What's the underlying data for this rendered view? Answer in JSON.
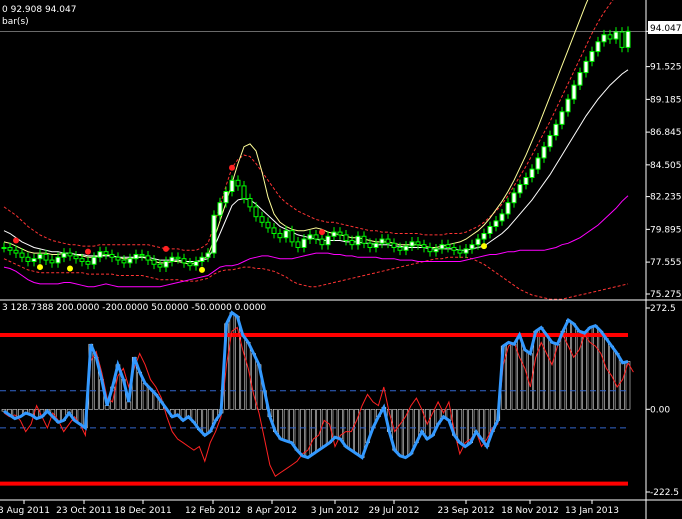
{
  "header": {
    "main_info": "0 92.908 94.047",
    "main_sub": "bar(s)",
    "osc_info": "3 128.7388 200.0000 -200.0000 50.0000 -50.0000 0.0000"
  },
  "price_tag": "94.047",
  "colors": {
    "background": "#000000",
    "grid": "#ffffff",
    "candle_bull": "#ffffff",
    "candle_body": "#00ff00",
    "ma_fast": "#ffffff",
    "ma_slow": "#ffff99",
    "band": "#ff3333",
    "lower_band": "#ff00ff",
    "cci": "#3399ff",
    "signal": "#ff2222",
    "level": "#ff0000",
    "dots_red": "#ff2222",
    "dots_yellow": "#ffff00"
  },
  "chart_data": [
    {
      "type": "candlestick",
      "ylim": [
        75.275,
        95.0
      ],
      "y_ticks": [
        "94.047",
        "91.525",
        "89.185",
        "86.845",
        "84.505",
        "82.235",
        "79.895",
        "77.555",
        "75.275"
      ],
      "y_tick_values": [
        94.047,
        91.525,
        89.185,
        86.845,
        84.505,
        82.235,
        79.895,
        77.555,
        75.275
      ],
      "x_ticks": [
        "3 Aug 2011",
        "23 Oct 2011",
        "18 Dec 2011",
        "12 Feb 2012",
        "8 Apr 2012",
        "3 Jun 2012",
        "29 Jul 2012",
        "23 Sep 2012",
        "18 Nov 2012",
        "13 Jan 2013"
      ],
      "close": [
        78.6,
        78.4,
        78.2,
        77.9,
        77.6,
        77.8,
        78.1,
        77.7,
        77.5,
        77.9,
        78.2,
        78.0,
        77.8,
        77.6,
        77.4,
        77.9,
        78.3,
        78.1,
        77.9,
        77.7,
        77.5,
        77.8,
        78.1,
        78.0,
        77.7,
        77.4,
        77.2,
        77.6,
        77.9,
        77.8,
        77.5,
        77.3,
        77.6,
        77.9,
        78.2,
        80.9,
        81.8,
        82.6,
        83.4,
        83.0,
        82.1,
        81.5,
        80.8,
        80.4,
        80.0,
        79.6,
        79.3,
        79.8,
        79.0,
        78.6,
        79.2,
        79.5,
        79.2,
        78.8,
        79.4,
        79.7,
        79.5,
        79.1,
        78.8,
        79.4,
        78.9,
        78.6,
        78.9,
        79.2,
        78.9,
        78.6,
        78.4,
        78.7,
        79.0,
        78.8,
        78.6,
        78.3,
        78.5,
        78.8,
        78.6,
        78.4,
        78.2,
        78.5,
        78.8,
        79.2,
        79.6,
        80.1,
        80.5,
        81.0,
        81.8,
        82.5,
        83.1,
        83.6,
        84.2,
        85.0,
        85.8,
        86.6,
        87.4,
        88.3,
        89.2,
        90.2,
        91.1,
        91.9,
        92.6,
        93.3,
        93.8,
        93.5,
        94.0,
        92.9,
        94.047
      ],
      "ma_fast": [
        79.8,
        79.6,
        79.3,
        79.0,
        78.8,
        78.6,
        78.5,
        78.4,
        78.3,
        78.3,
        78.2,
        78.2,
        78.1,
        78.1,
        78.0,
        78.0,
        78.0,
        78.0,
        78.0,
        77.9,
        77.9,
        77.9,
        77.9,
        77.9,
        77.9,
        77.8,
        77.7,
        77.7,
        77.7,
        77.7,
        77.6,
        77.6,
        77.6,
        77.7,
        77.8,
        78.6,
        79.6,
        80.6,
        81.6,
        82.0,
        82.1,
        82.0,
        81.7,
        81.3,
        80.9,
        80.5,
        80.1,
        79.9,
        79.7,
        79.5,
        79.4,
        79.3,
        79.2,
        79.1,
        79.1,
        79.1,
        79.1,
        79.0,
        79.0,
        79.0,
        78.9,
        78.9,
        78.8,
        78.8,
        78.8,
        78.7,
        78.7,
        78.6,
        78.6,
        78.6,
        78.6,
        78.5,
        78.5,
        78.5,
        78.5,
        78.5,
        78.4,
        78.4,
        78.5,
        78.6,
        78.7,
        79.0,
        79.3,
        79.6,
        80.0,
        80.5,
        81.0,
        81.5,
        82.0,
        82.6,
        83.2,
        83.8,
        84.5,
        85.2,
        85.9,
        86.6,
        87.3,
        88.0,
        88.6,
        89.2,
        89.7,
        90.2,
        90.6,
        91.0,
        91.3
      ],
      "ma_slow": [
        79.0,
        78.9,
        78.7,
        78.5,
        78.3,
        78.2,
        78.2,
        78.2,
        78.1,
        78.1,
        78.2,
        78.2,
        78.1,
        78.0,
        77.9,
        77.9,
        78.0,
        78.1,
        78.0,
        77.9,
        77.8,
        77.8,
        77.9,
        77.9,
        77.8,
        77.6,
        77.5,
        77.5,
        77.6,
        77.6,
        77.5,
        77.4,
        77.5,
        77.7,
        78.0,
        79.2,
        80.5,
        81.8,
        83.2,
        84.6,
        85.8,
        86.0,
        85.5,
        84.0,
        82.2,
        81.0,
        80.4,
        80.1,
        79.9,
        79.8,
        79.8,
        79.9,
        80.0,
        79.9,
        79.7,
        79.6,
        79.5,
        79.4,
        79.3,
        79.3,
        79.2,
        79.1,
        79.0,
        79.0,
        79.0,
        78.9,
        78.8,
        78.8,
        78.8,
        78.8,
        78.7,
        78.6,
        78.6,
        78.7,
        78.8,
        78.9,
        79.0,
        79.2,
        79.5,
        79.8,
        80.2,
        80.7,
        81.3,
        81.9,
        82.6,
        83.4,
        84.3,
        85.2,
        86.2,
        87.2,
        88.3,
        89.4,
        90.5,
        91.6,
        92.7,
        93.8,
        94.9,
        96.0,
        97.0,
        98.0,
        99.0,
        100.0,
        101.0,
        102.0,
        103.0
      ],
      "band_upper": [
        81.5,
        81.2,
        80.9,
        80.5,
        80.1,
        79.8,
        79.5,
        79.3,
        79.1,
        79.0,
        78.9,
        78.8,
        78.8,
        78.7,
        78.7,
        78.7,
        78.8,
        78.8,
        78.8,
        78.8,
        78.8,
        78.8,
        78.8,
        78.8,
        78.8,
        78.7,
        78.6,
        78.5,
        78.5,
        78.5,
        78.4,
        78.4,
        78.4,
        78.6,
        78.9,
        80.2,
        81.6,
        83.0,
        84.3,
        84.9,
        85.2,
        85.1,
        84.6,
        84.0,
        83.4,
        82.8,
        82.2,
        81.8,
        81.5,
        81.2,
        81.0,
        80.8,
        80.6,
        80.5,
        80.4,
        80.4,
        80.3,
        80.2,
        80.1,
        80.0,
        79.9,
        79.8,
        79.8,
        79.7,
        79.7,
        79.6,
        79.6,
        79.6,
        79.6,
        79.6,
        79.5,
        79.5,
        79.5,
        79.5,
        79.6,
        79.6,
        79.6,
        79.7,
        79.9,
        80.1,
        80.4,
        80.8,
        81.2,
        81.7,
        82.3,
        83.0,
        83.7,
        84.4,
        85.2,
        86.0,
        86.8,
        87.6,
        88.5,
        89.4,
        90.3,
        91.2,
        92.1,
        93.0,
        93.9,
        94.7,
        95.4,
        96.0,
        96.6,
        97.1,
        97.5
      ],
      "band_lower": [
        77.8,
        77.6,
        77.4,
        77.2,
        77.0,
        76.9,
        76.8,
        76.8,
        76.8,
        76.8,
        76.8,
        76.8,
        76.8,
        76.8,
        76.7,
        76.7,
        76.7,
        76.7,
        76.7,
        76.6,
        76.6,
        76.6,
        76.6,
        76.6,
        76.5,
        76.4,
        76.3,
        76.3,
        76.3,
        76.3,
        76.2,
        76.2,
        76.2,
        76.3,
        76.4,
        76.7,
        76.9,
        77.0,
        77.0,
        77.1,
        77.2,
        77.2,
        77.1,
        77.1,
        77.0,
        76.9,
        76.7,
        76.5,
        76.2,
        76.0,
        75.9,
        75.8,
        75.8,
        75.9,
        76.0,
        76.1,
        76.2,
        76.3,
        76.4,
        76.5,
        76.6,
        76.7,
        76.8,
        76.9,
        77.0,
        77.1,
        77.2,
        77.3,
        77.4,
        77.5,
        77.6,
        77.7,
        77.8,
        77.8,
        77.9,
        77.9,
        77.9,
        77.9,
        77.8,
        77.6,
        77.4,
        77.1,
        76.8,
        76.5,
        76.2,
        75.9,
        75.6,
        75.4,
        75.2,
        75.1,
        75.0,
        74.9,
        74.9,
        74.9,
        75.0,
        75.1,
        75.2,
        75.3,
        75.4,
        75.5,
        75.6,
        75.7,
        75.8,
        75.9,
        76.0
      ],
      "lower_line": [
        77.2,
        77.1,
        76.9,
        76.6,
        76.3,
        76.1,
        76.0,
        76.0,
        76.0,
        76.0,
        76.1,
        76.1,
        76.0,
        75.9,
        75.8,
        75.8,
        75.9,
        76.0,
        75.9,
        75.8,
        75.8,
        75.8,
        75.8,
        75.8,
        75.8,
        75.8,
        75.8,
        75.9,
        76.0,
        76.1,
        76.2,
        76.3,
        76.4,
        76.5,
        76.6,
        76.9,
        77.2,
        77.3,
        77.3,
        77.4,
        77.6,
        77.8,
        77.9,
        78.0,
        78.0,
        77.9,
        77.8,
        77.8,
        77.8,
        77.9,
        78.0,
        78.1,
        78.2,
        78.2,
        78.2,
        78.1,
        78.1,
        78.0,
        78.0,
        77.9,
        77.9,
        77.9,
        77.9,
        77.8,
        77.8,
        77.8,
        77.7,
        77.7,
        77.7,
        77.6,
        77.6,
        77.6,
        77.6,
        77.6,
        77.6,
        77.6,
        77.6,
        77.7,
        77.8,
        77.9,
        78.0,
        78.1,
        78.1,
        78.2,
        78.3,
        78.3,
        78.4,
        78.4,
        78.4,
        78.4,
        78.4,
        78.5,
        78.6,
        78.8,
        78.9,
        79.1,
        79.3,
        79.6,
        79.9,
        80.2,
        80.6,
        81.0,
        81.4,
        81.9,
        82.3
      ],
      "dots_red_idx": [
        2,
        14,
        27,
        38,
        53
      ],
      "dots_yellow_idx": [
        6,
        11,
        33,
        80
      ]
    },
    {
      "type": "line",
      "ylim": [
        -222.5,
        272.5
      ],
      "y_ticks": [
        "272.5",
        "0.00",
        "-222.5"
      ],
      "y_tick_values": [
        272.5,
        0,
        -222.5
      ],
      "levels": [
        200,
        50,
        -50,
        -200
      ],
      "cci": [
        -5,
        -15,
        -25,
        -20,
        -10,
        -15,
        -25,
        -20,
        -5,
        -20,
        -35,
        -30,
        -10,
        -30,
        -40,
        -50,
        175,
        140,
        80,
        10,
        60,
        120,
        80,
        20,
        140,
        100,
        70,
        55,
        40,
        20,
        0,
        -20,
        -15,
        -30,
        -20,
        -35,
        -55,
        -70,
        -60,
        -30,
        -10,
        230,
        260,
        250,
        200,
        180,
        150,
        120,
        50,
        -20,
        -60,
        -80,
        -85,
        -90,
        -110,
        -125,
        -130,
        -120,
        -110,
        -100,
        -90,
        -75,
        -80,
        -100,
        -110,
        -120,
        -130,
        -90,
        -50,
        -20,
        5,
        -60,
        -110,
        -125,
        -130,
        -120,
        -90,
        -60,
        -80,
        -70,
        -40,
        -20,
        -30,
        -70,
        -90,
        -100,
        -90,
        -60,
        -80,
        -100,
        -60,
        -30,
        170,
        180,
        175,
        200,
        160,
        150,
        210,
        220,
        200,
        180,
        175,
        210,
        240,
        230,
        210,
        205,
        220,
        225,
        210,
        190,
        170,
        150,
        125,
        128.7
      ],
      "signal": [
        -10,
        -20,
        -15,
        -30,
        -60,
        -40,
        10,
        -20,
        -50,
        -10,
        -30,
        -60,
        -40,
        -20,
        -40,
        -70,
        130,
        155,
        100,
        30,
        20,
        90,
        110,
        60,
        110,
        150,
        120,
        80,
        60,
        30,
        -20,
        -60,
        -80,
        -90,
        -100,
        -110,
        -100,
        -140,
        -90,
        -60,
        -20,
        120,
        210,
        220,
        160,
        110,
        40,
        -10,
        -80,
        -150,
        -180,
        -170,
        -160,
        -150,
        -140,
        -120,
        -110,
        -80,
        -70,
        -30,
        -40,
        -100,
        -70,
        -60,
        -60,
        -30,
        10,
        40,
        20,
        10,
        60,
        -10,
        -60,
        -40,
        -20,
        10,
        30,
        0,
        -40,
        -10,
        20,
        -10,
        20,
        -60,
        -120,
        -90,
        -80,
        -60,
        -100,
        -80,
        -50,
        -40,
        120,
        170,
        180,
        140,
        110,
        60,
        140,
        180,
        150,
        120,
        170,
        200,
        170,
        140,
        160,
        200,
        180,
        170,
        150,
        110,
        90,
        60,
        80,
        125,
        100
      ]
    }
  ]
}
